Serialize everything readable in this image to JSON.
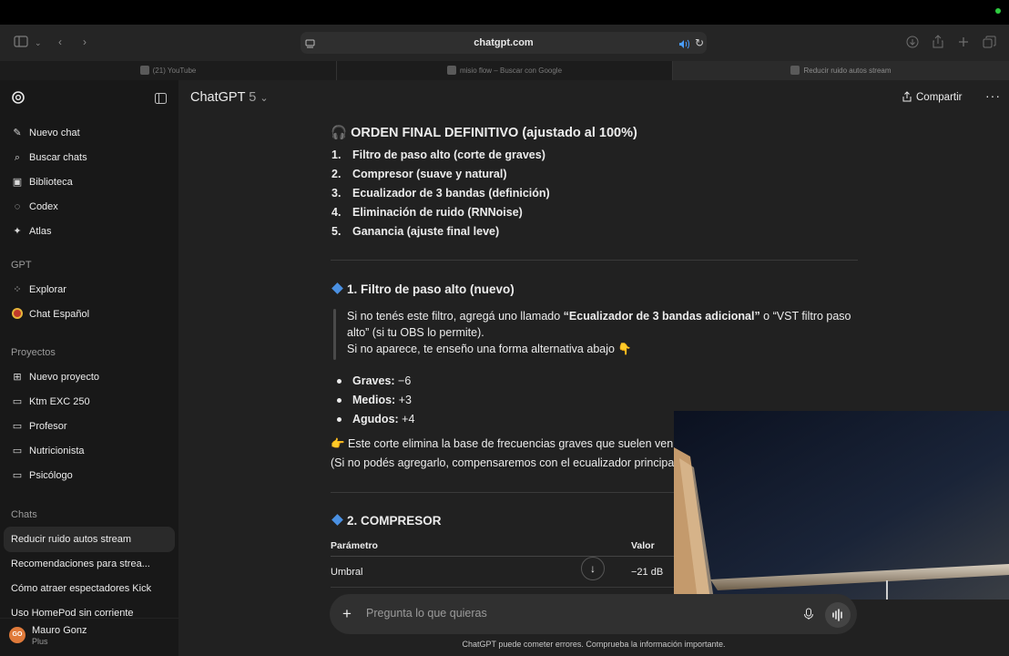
{
  "browser": {
    "url": "chatgpt.com",
    "tabs": [
      {
        "label": "(21) YouTube",
        "active": false
      },
      {
        "label": "misio flow – Buscar con Google",
        "active": false
      },
      {
        "label": "Reducir ruido autos stream",
        "active": true
      }
    ]
  },
  "sidebar": {
    "nav": [
      {
        "label": "Nuevo chat",
        "icon": "edit-icon"
      },
      {
        "label": "Buscar chats",
        "icon": "search-icon"
      },
      {
        "label": "Biblioteca",
        "icon": "library-icon"
      },
      {
        "label": "Codex",
        "icon": "codex-icon"
      },
      {
        "label": "Atlas",
        "icon": "atlas-icon"
      }
    ],
    "gpt_header": "GPT",
    "gpts": [
      {
        "label": "Explorar",
        "icon": "grid-icon"
      },
      {
        "label": "Chat Español",
        "icon": "gpt-avatar-icon"
      }
    ],
    "projects_header": "Proyectos",
    "projects": [
      {
        "label": "Nuevo proyecto",
        "icon": "new-folder-icon"
      },
      {
        "label": "Ktm EXC 250",
        "icon": "folder-icon"
      },
      {
        "label": "Profesor",
        "icon": "folder-icon"
      },
      {
        "label": "Nutricionista",
        "icon": "folder-icon"
      },
      {
        "label": "Psicólogo",
        "icon": "folder-icon"
      }
    ],
    "chats_header": "Chats",
    "chats": [
      "Reducir ruido autos stream",
      "Recomendaciones para strea...",
      "Cómo atraer espectadores Kick",
      "Uso HomePod sin corriente"
    ],
    "user": {
      "name": "Mauro Gonz",
      "plan": "Plus",
      "initials": "GO"
    }
  },
  "header": {
    "model": "ChatGPT",
    "version": "5",
    "share_label": "Compartir"
  },
  "content": {
    "title": "ORDEN FINAL DEFINITIVO (ajustado al 100%)",
    "steps": [
      {
        "n": "1.",
        "text": "Filtro de paso alto (corte de graves)"
      },
      {
        "n": "2.",
        "text": "Compresor (suave y natural)"
      },
      {
        "n": "3.",
        "text": "Ecualizador de 3 bandas (definición)"
      },
      {
        "n": "4.",
        "text": "Eliminación de ruido (RNNoise)"
      },
      {
        "n": "5.",
        "text": "Ganancia (ajuste final leve)"
      }
    ],
    "section1_title": "1. Filtro de paso alto (nuevo)",
    "quote": {
      "l1a": "Si no tenés este filtro, agregá uno llamado ",
      "l1b": "“Ecualizador de 3 bandas adicional”",
      "l1c": " o “VST filtro paso",
      "l2": "alto” (si tu OBS lo permite).",
      "l3": "Si no aparece, te enseño una forma alternativa abajo 👇"
    },
    "bullets": [
      {
        "label": "Graves:",
        "value": "−6"
      },
      {
        "label": "Medios:",
        "value": "+3"
      },
      {
        "label": "Agudos:",
        "value": "+4"
      }
    ],
    "note1": "👉 Este corte elimina la base de frecuencias graves que suelen venir",
    "note2": "(Si no podés agregarlo, compensaremos con el ecualizador principal",
    "section2_title": "2. COMPRESOR",
    "table": {
      "headers": [
        "Parámetro",
        "Valor"
      ],
      "rows": [
        {
          "param": "Umbral",
          "value": "−21 dB"
        }
      ]
    }
  },
  "composer": {
    "placeholder": "Pregunta lo que quieras"
  },
  "footer": "ChatGPT puede cometer errores. Comprueba la información importante."
}
